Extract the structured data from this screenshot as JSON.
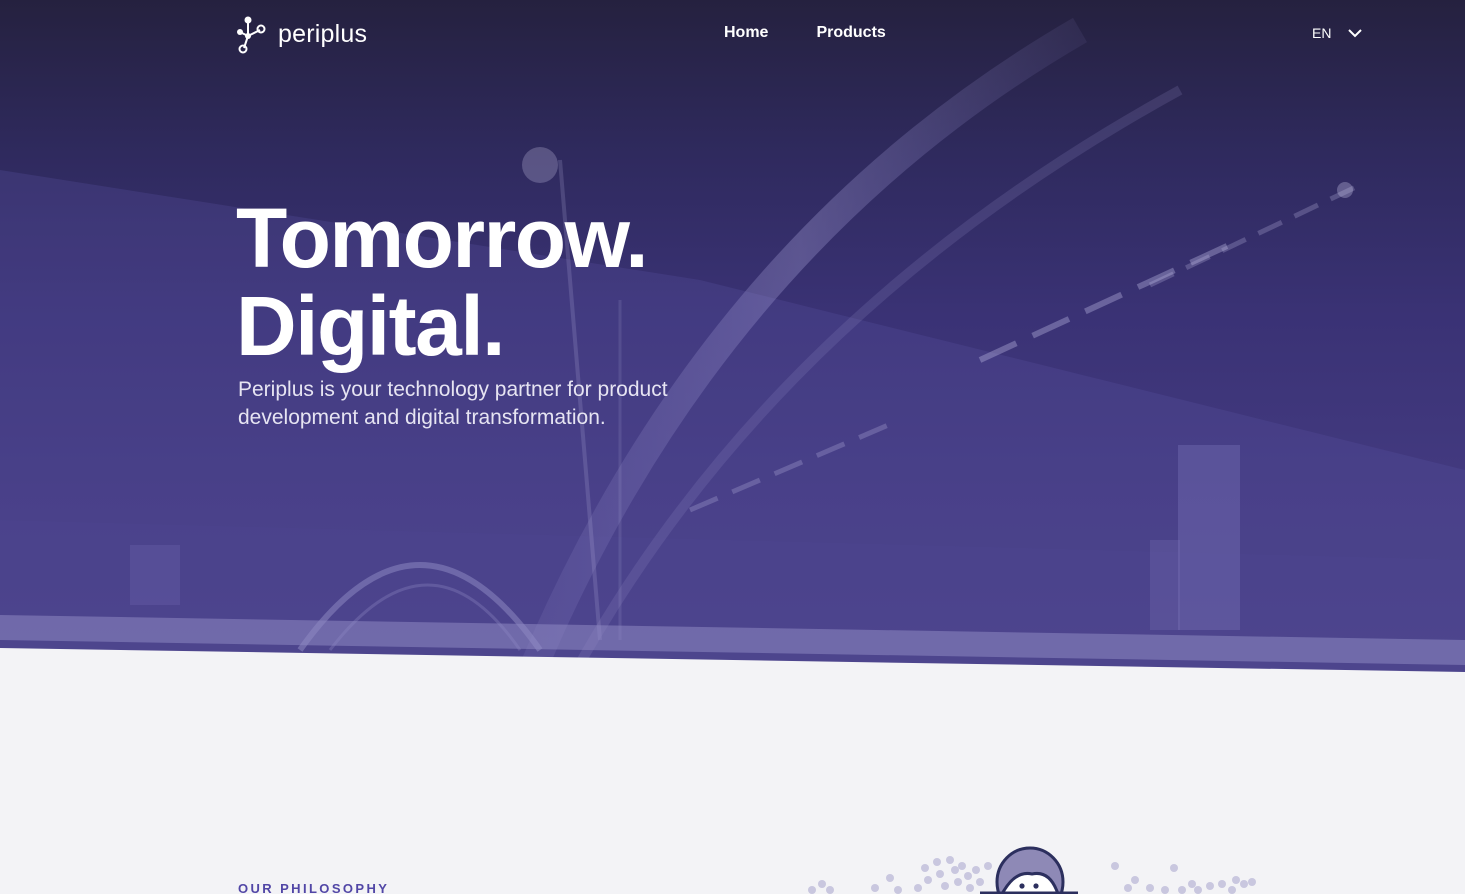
{
  "brand": {
    "name": "periplus",
    "logo_icon": "molecule-nodes-icon"
  },
  "nav": {
    "items": [
      {
        "label": "Home"
      },
      {
        "label": "Products"
      }
    ],
    "language": {
      "selected": "EN",
      "icon": "chevron-down-icon"
    }
  },
  "hero": {
    "headline_line1": "Tomorrow.",
    "headline_line2": "Digital.",
    "description": "Periplus is your technology partner for product development and digital transformation."
  },
  "philosophy": {
    "label": "OUR PHILOSOPHY",
    "illustration_icon": "person-with-dots-illustration"
  },
  "colors": {
    "hero_top": "#25213f",
    "hero_bottom": "#4a4287",
    "accent": "#5146a6",
    "page_background": "#f3f3f6"
  }
}
